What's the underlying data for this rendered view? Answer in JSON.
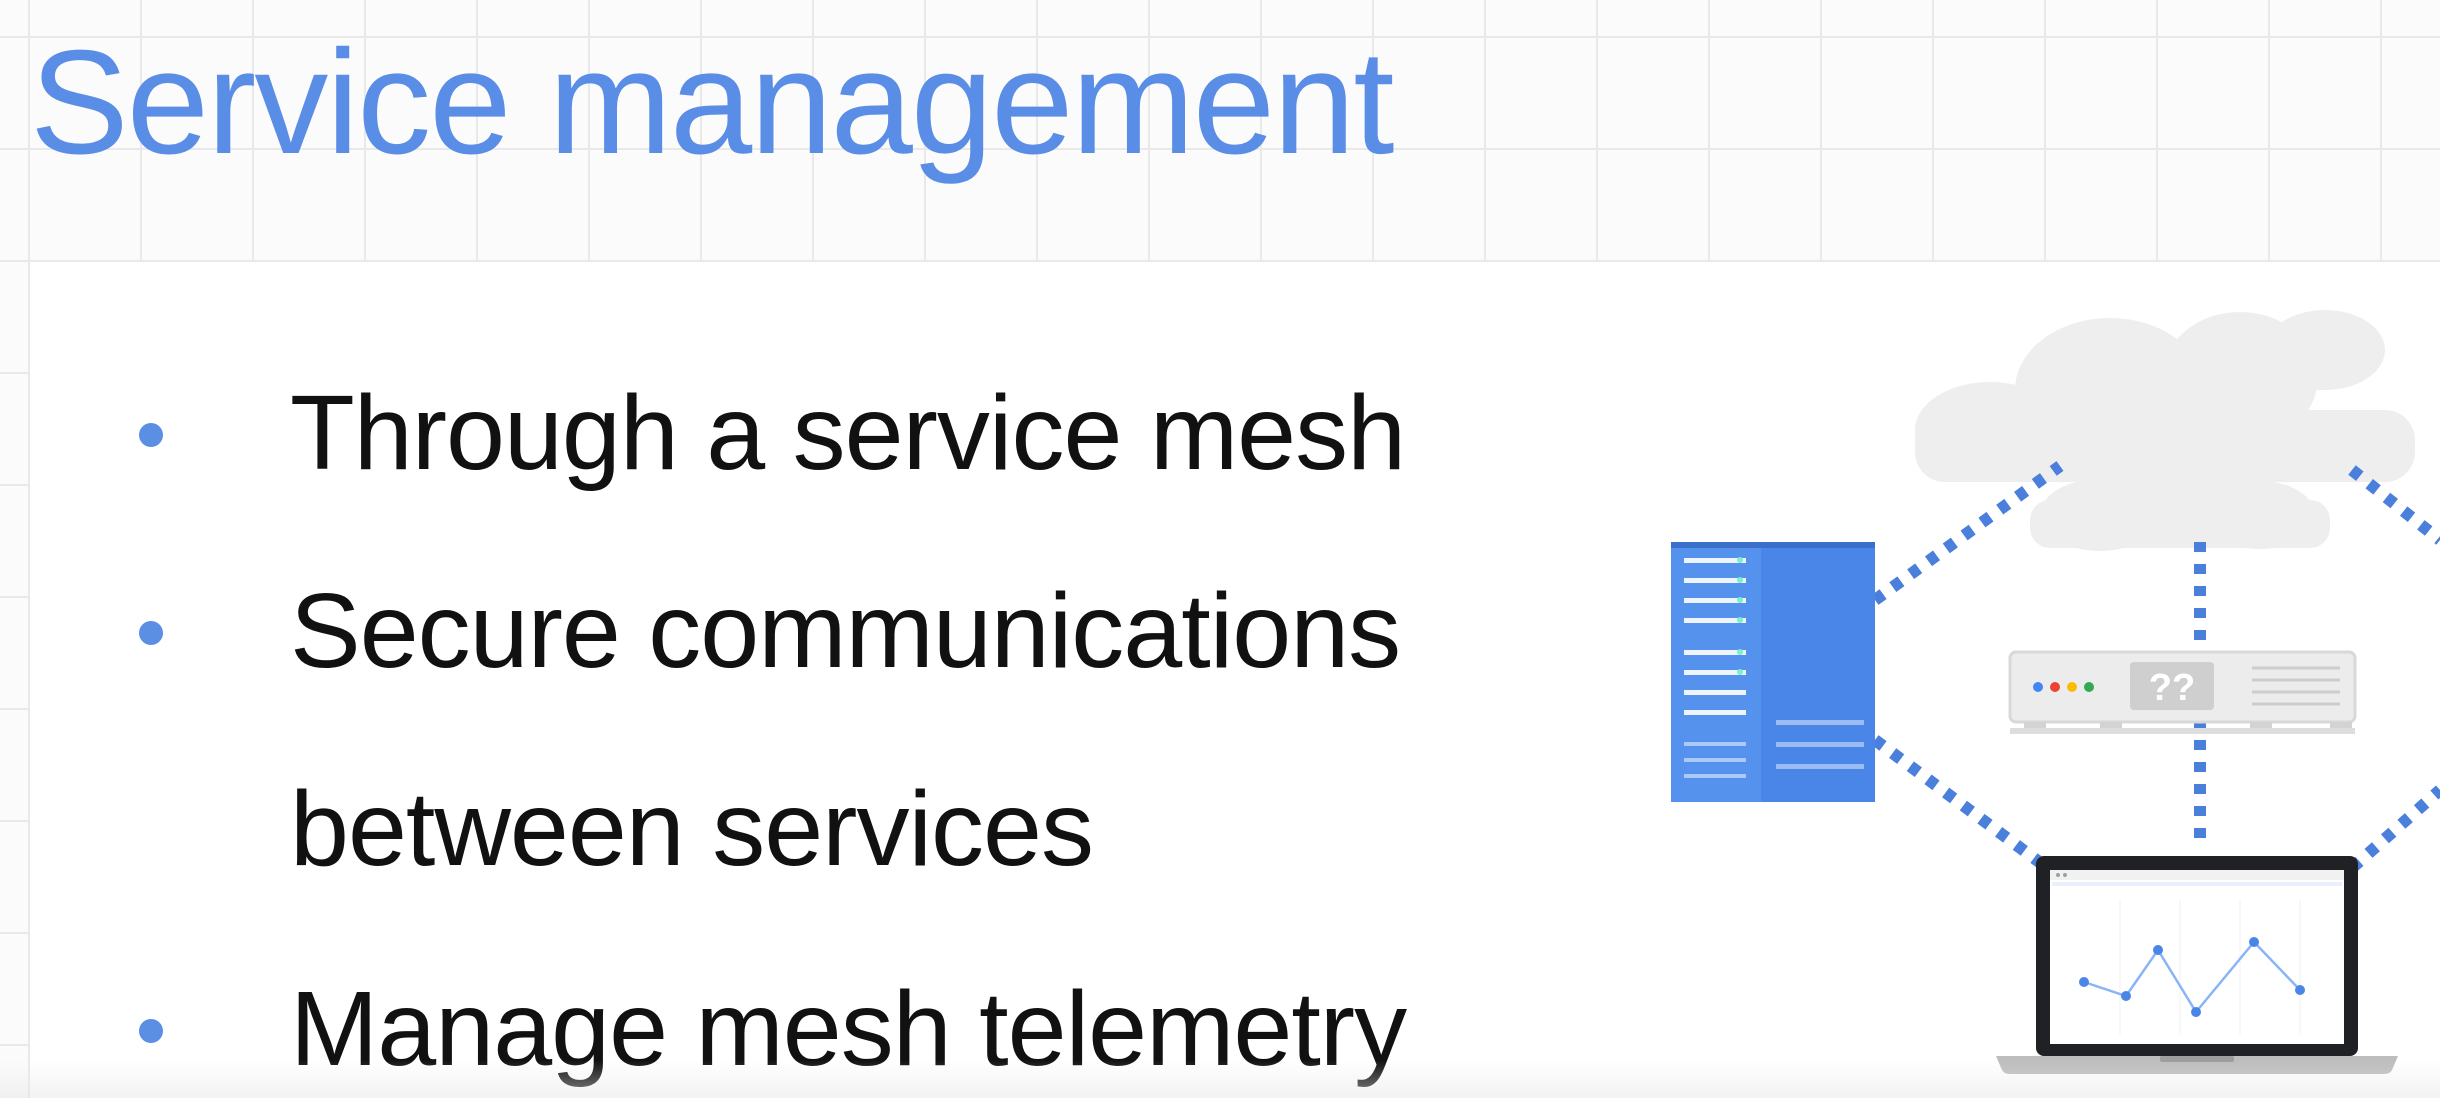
{
  "slide": {
    "title": "Service management",
    "title_color": "#5a8de6",
    "bullet_color": "#5b8fe3",
    "bullets": [
      {
        "lines": [
          "Through a service mesh"
        ]
      },
      {
        "lines": [
          "Secure communications",
          "between services"
        ]
      },
      {
        "lines": [
          "Manage mesh telemetry"
        ]
      }
    ]
  },
  "illustration": {
    "server_label": "??",
    "server_lights": [
      "#4285f4",
      "#ea4335",
      "#fbbc04",
      "#34a853"
    ],
    "link_color": "#4a80dc",
    "icons": [
      "cloud-icon",
      "blue-server-rack-icon",
      "router-device-icon",
      "laptop-icon",
      "line-graph-icon"
    ]
  }
}
